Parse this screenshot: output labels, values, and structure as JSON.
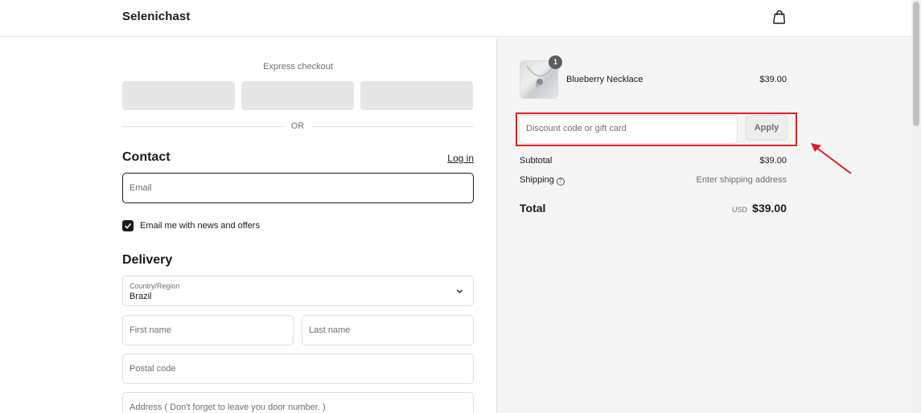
{
  "header": {
    "brand": "Selenichast",
    "cart_icon": "shopping-bag-icon"
  },
  "express": {
    "label": "Express checkout",
    "or_text": "OR"
  },
  "contact": {
    "title": "Contact",
    "login_link": "Log in",
    "email_placeholder": "Email",
    "newsletter_label": "Email me with news and offers",
    "newsletter_checked": true
  },
  "delivery": {
    "title": "Delivery",
    "country_label": "Country/Region",
    "country_value": "Brazil",
    "first_name_placeholder": "First name",
    "last_name_placeholder": "Last name",
    "postal_placeholder": "Postal code",
    "address_placeholder": "Address ( Don't forget to leave you door number. )"
  },
  "order": {
    "product": {
      "name": "Blueberry Necklace",
      "price": "$39.00",
      "quantity": "1"
    },
    "discount_placeholder": "Discount code or gift card",
    "apply_label": "Apply",
    "subtotal_label": "Subtotal",
    "subtotal_value": "$39.00",
    "shipping_label": "Shipping",
    "shipping_value": "Enter shipping address",
    "total_label": "Total",
    "total_currency": "USD",
    "total_value": "$39.00"
  },
  "colors": {
    "highlight": "#e02020",
    "panel_bg": "#f5f5f5",
    "text": "#1a1a1a"
  }
}
